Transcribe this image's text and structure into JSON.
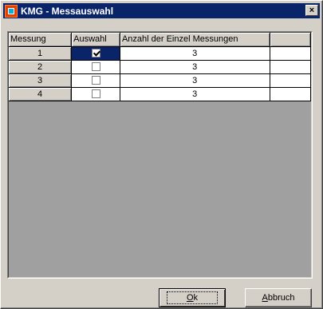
{
  "window": {
    "title": "KMG - Messauswahl"
  },
  "titlebar": {
    "close_glyph": "×"
  },
  "grid": {
    "columns": [
      "Messung",
      "Auswahl",
      "Anzahl der Einzel Messungen",
      ""
    ],
    "rows": [
      {
        "messung": "1",
        "auswahl": true,
        "anzahl": "3",
        "selected": true
      },
      {
        "messung": "2",
        "auswahl": false,
        "anzahl": "3",
        "selected": false
      },
      {
        "messung": "3",
        "auswahl": false,
        "anzahl": "3",
        "selected": false
      },
      {
        "messung": "4",
        "auswahl": false,
        "anzahl": "3",
        "selected": false
      }
    ]
  },
  "buttons": {
    "ok_label": "Ok",
    "ok_mnemonic": "O",
    "ok_rest": "k",
    "cancel_mnemonic": "A",
    "cancel_rest": "bbruch",
    "cancel_label": "Abbruch"
  },
  "colors": {
    "titlebar": "#0a246a",
    "window_bg": "#d4d0c8",
    "grid_empty_bg": "#a0a0a0",
    "selection": "#0a246a"
  }
}
